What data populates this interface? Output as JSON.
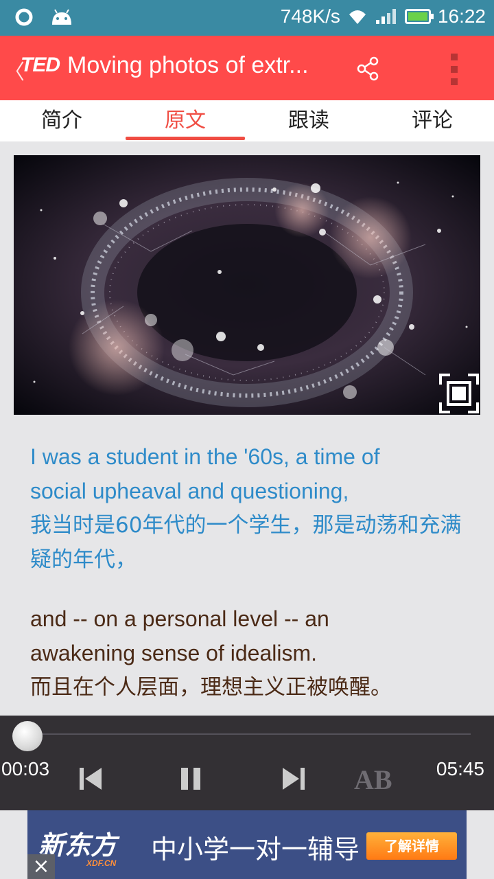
{
  "status_bar": {
    "speed": "748K/s",
    "time": "16:22"
  },
  "app_bar": {
    "back_glyph": "〈",
    "logo": "TED",
    "title": "Moving photos of extr...",
    "share_icon": "share-icon",
    "more_icon": "more-vertical-icon"
  },
  "tabs": [
    {
      "label": "简介"
    },
    {
      "label": "原文",
      "active": true
    },
    {
      "label": "跟读"
    },
    {
      "label": "评论"
    }
  ],
  "transcript": [
    {
      "en": "I was a student in the '60s, a time of social upheaval and questioning,",
      "zh": "我当时是60年代的一个学生，那是动荡和充满疑的年代，",
      "active": true
    },
    {
      "en": "and -- on a personal level -- an awakening sense of idealism.",
      "zh": "而且在个人层面，理想主义正被唤醒。",
      "active": false
    }
  ],
  "player": {
    "elapsed": "00:03",
    "duration": "05:45",
    "progress": 0.009,
    "ab_label": "AB"
  },
  "ad": {
    "brand": "新东方",
    "brand_sub": "XDF.CN",
    "text": "中小学一对一辅导",
    "cta": "了解详情",
    "close": "×"
  },
  "colors": {
    "accent": "#ff4a4a",
    "status_bar": "#3a8aa3",
    "transcript_active": "#2e8bc9",
    "transcript_inactive": "#4b2a16"
  }
}
